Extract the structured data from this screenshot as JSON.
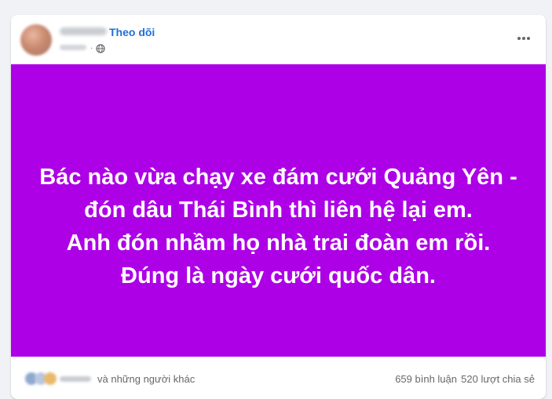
{
  "post": {
    "follow_label": "Theo dõi",
    "background_color": "#ad00e6",
    "text_lines": [
      "Bác nào vừa chạy xe đám cưới Quảng Yên -",
      "đón dâu Thái Bình thì liên hệ lại em.",
      "Anh đón nhầm họ nhà trai đoàn em rồi.",
      "Đúng là ngày cưới quốc dân."
    ]
  },
  "footer": {
    "others_label": "và những người khác",
    "comments_label": "659 bình luận",
    "shares_label": "520 lượt chia sẻ"
  },
  "icons": {
    "globe": "globe-icon",
    "more": "more-options-icon"
  }
}
